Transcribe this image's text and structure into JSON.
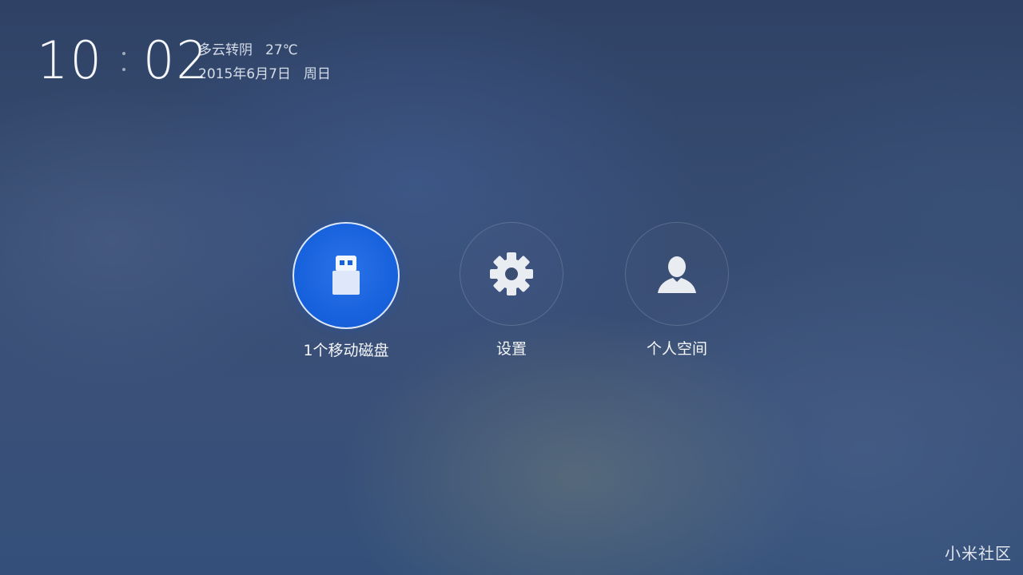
{
  "clock": {
    "hours": "10",
    "minutes": "02"
  },
  "weather": {
    "condition": "多云转阴",
    "temperature": "27℃"
  },
  "date": {
    "date_text": "2015年6月7日",
    "weekday": "周日"
  },
  "menu": {
    "items": [
      {
        "label": "1个移动磁盘",
        "icon": "usb-drive-icon",
        "selected": true
      },
      {
        "label": "设置",
        "icon": "gear-icon",
        "selected": false
      },
      {
        "label": "个人空间",
        "icon": "person-icon",
        "selected": false
      }
    ]
  },
  "watermark": {
    "text": "小米社区"
  },
  "colors": {
    "selected_tile": "#1862dd",
    "background": "#34496f",
    "text": "#ffffff"
  }
}
